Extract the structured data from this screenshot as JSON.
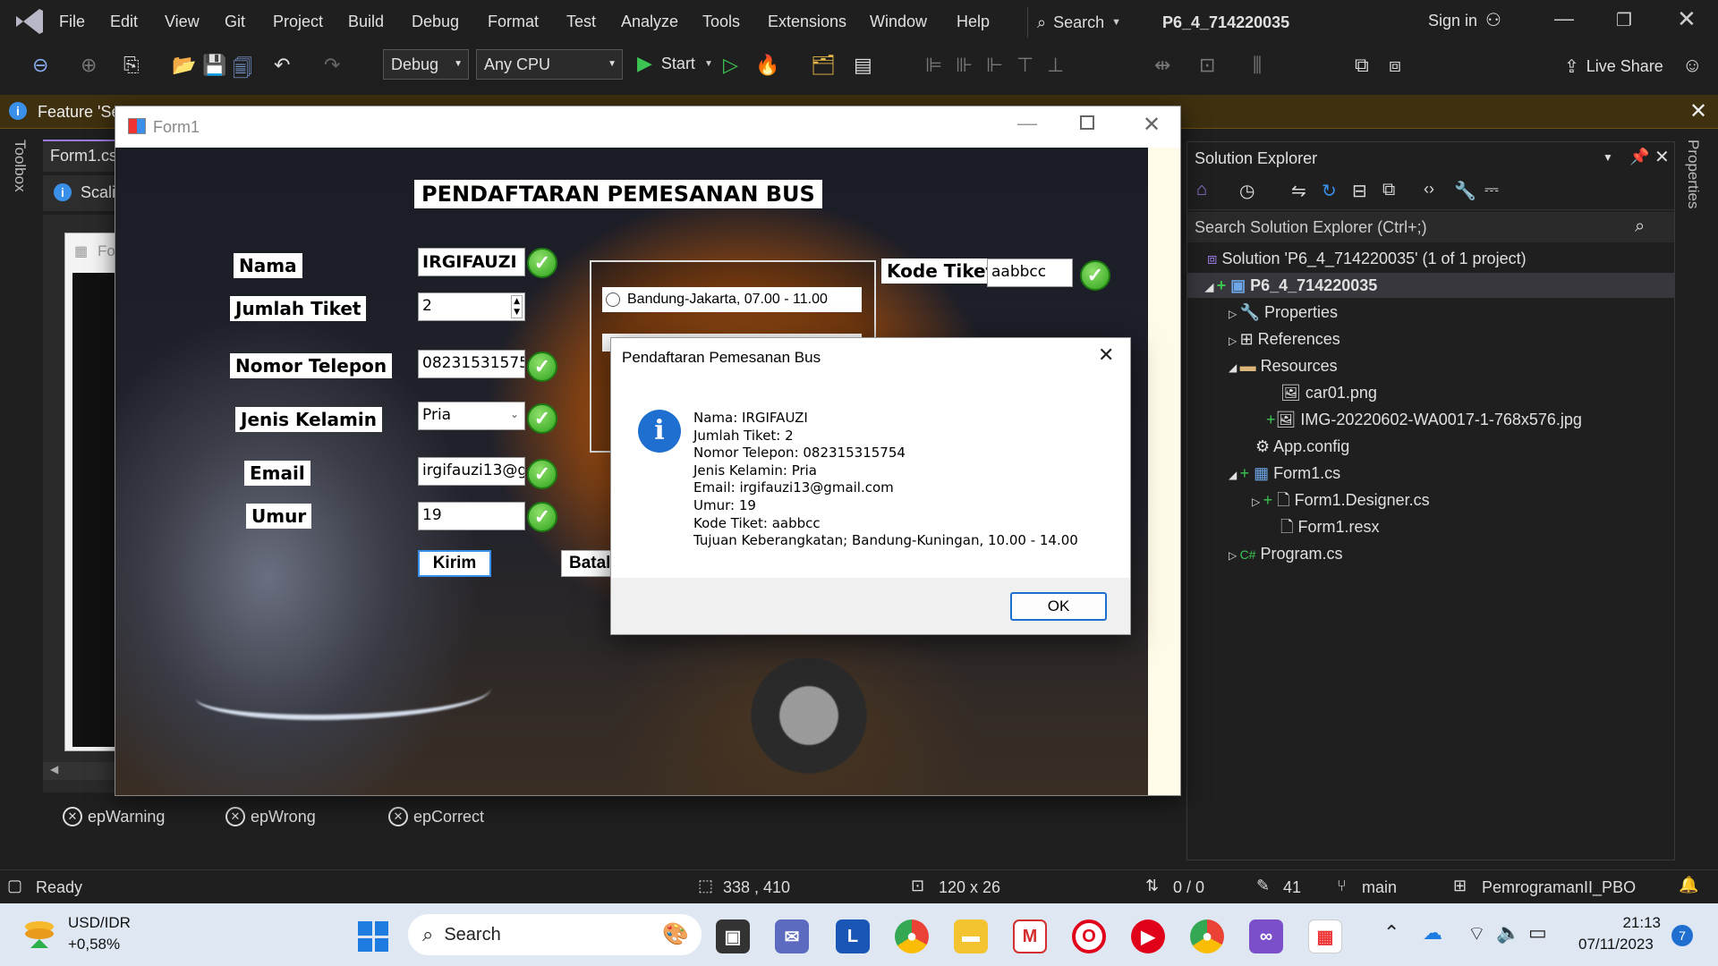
{
  "menubar": {
    "items": [
      "File",
      "Edit",
      "View",
      "Git",
      "Project",
      "Build",
      "Debug",
      "Format",
      "Test",
      "Analyze",
      "Tools",
      "Extensions",
      "Window",
      "Help"
    ],
    "search_label": "Search",
    "solution_name": "P6_4_714220035",
    "sign_in": "Sign in"
  },
  "toolbar": {
    "config": "Debug",
    "platform": "Any CPU",
    "start_label": "Start",
    "live_share": "Live Share"
  },
  "infobar": {
    "text": "Feature 'Se"
  },
  "side_tabs": {
    "toolbox": "Toolbox",
    "properties": "Properties"
  },
  "editor": {
    "tab_label": "Form1.cs",
    "scaling_text": "Scali",
    "designer_form_label": "Fo"
  },
  "tray": {
    "items": [
      "epWarning",
      "epWrong",
      "epCorrect"
    ]
  },
  "form": {
    "title": "Form1",
    "heading": "PENDAFTARAN PEMESANAN BUS",
    "labels": {
      "nama": "Nama",
      "jumlah_tiket": "Jumlah Tiket",
      "nomor_telepon": "Nomor Telepon",
      "jenis_kelamin": "Jenis Kelamin",
      "email": "Email",
      "umur": "Umur",
      "kode_tiket": "Kode Tiket"
    },
    "values": {
      "nama": "IRGIFAUZI",
      "jumlah_tiket": "2",
      "nomor_telepon": "082315315754",
      "jenis_kelamin": "Pria",
      "email": "irgifauzi13@gma",
      "umur": "19",
      "kode_tiket": "aabbcc"
    },
    "route_option": "Bandung-Jakarta, 07.00 - 11.00",
    "kirim": "Kirim",
    "batal": "Batal"
  },
  "msgbox": {
    "title": "Pendaftaran Pemesanan Bus",
    "lines": [
      "Nama: IRGIFAUZI",
      "Jumlah Tiket: 2",
      "Nomor Telepon: 082315315754",
      "Jenis Kelamin: Pria",
      "Email: irgifauzi13@gmail.com",
      "Umur: 19",
      "Kode Tiket: aabbcc",
      "Tujuan Keberangkatan; Bandung-Kuningan, 10.00 - 14.00"
    ],
    "ok": "OK"
  },
  "solution_explorer": {
    "title": "Solution Explorer",
    "search_placeholder": "Search Solution Explorer (Ctrl+;)",
    "nodes": [
      "Solution 'P6_4_714220035' (1 of 1 project)",
      "P6_4_714220035",
      "Properties",
      "References",
      "Resources",
      "car01.png",
      "IMG-20220602-WA0017-1-768x576.jpg",
      "App.config",
      "Form1.cs",
      "Form1.Designer.cs",
      "Form1.resx",
      "Program.cs"
    ]
  },
  "statusbar": {
    "ready": "Ready",
    "position": "338 , 410",
    "size": "120 x 26",
    "errors": "0 / 0",
    "edits": "41",
    "branch": "main",
    "repo": "PemrogramanII_PBO"
  },
  "taskbar": {
    "ticker_name": "USD/IDR",
    "ticker_change": "+0,58%",
    "search": "Search",
    "time": "21:13",
    "date": "07/11/2023",
    "notif_count": "7"
  }
}
